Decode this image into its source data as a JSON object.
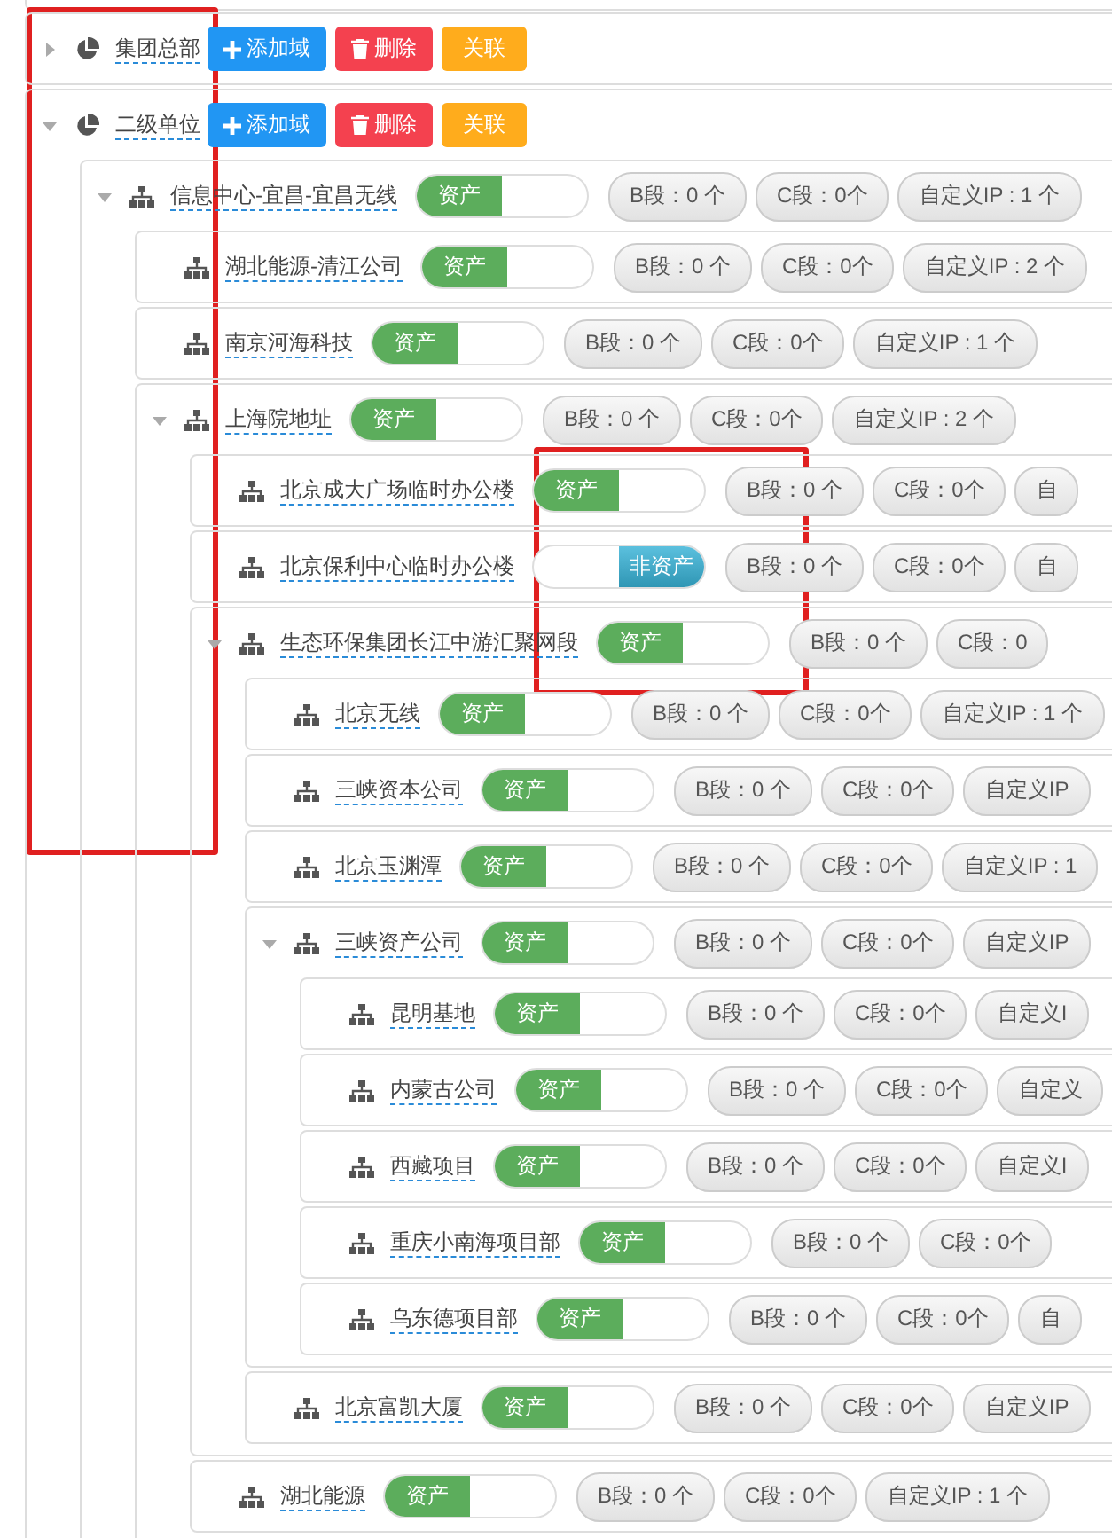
{
  "tree": [
    {
      "kind": "domain",
      "name": "集团总部",
      "expanded": false,
      "buttons": [
        {
          "kind": "add",
          "label": "添加域"
        },
        {
          "kind": "delete",
          "label": "删除"
        },
        {
          "kind": "link",
          "label": "关联"
        }
      ]
    },
    {
      "kind": "domain",
      "name": "二级单位",
      "expanded": true,
      "buttons": [
        {
          "kind": "add",
          "label": "添加域"
        },
        {
          "kind": "delete",
          "label": "删除"
        },
        {
          "kind": "link",
          "label": "关联"
        }
      ],
      "children": [
        {
          "kind": "site",
          "name": "信息中心-宜昌-宜昌无线",
          "expanded": true,
          "asset": true,
          "asset_label": "资产",
          "segments": [
            "B段：0 个",
            "C段：0个",
            "自定义IP : 1 个"
          ],
          "children": [
            {
              "kind": "site",
              "name": "湖北能源-清江公司",
              "asset": true,
              "asset_label": "资产",
              "segments": [
                "B段：0 个",
                "C段：0个",
                "自定义IP : 2 个"
              ]
            },
            {
              "kind": "site",
              "name": "南京河海科技",
              "asset": true,
              "asset_label": "资产",
              "segments": [
                "B段：0 个",
                "C段：0个",
                "自定义IP : 1 个"
              ]
            },
            {
              "kind": "site",
              "name": "上海院地址",
              "expanded": true,
              "asset": true,
              "asset_label": "资产",
              "segments": [
                "B段：0 个",
                "C段：0个",
                "自定义IP : 2 个"
              ],
              "children": [
                {
                  "kind": "site",
                  "name": "北京成大广场临时办公楼",
                  "asset": true,
                  "asset_label": "资产",
                  "segments": [
                    "B段：0 个",
                    "C段：0个",
                    "自"
                  ]
                },
                {
                  "kind": "site",
                  "name": "北京保利中心临时办公楼",
                  "asset": false,
                  "asset_label": "非资产",
                  "segments": [
                    "B段：0 个",
                    "C段：0个",
                    "自"
                  ]
                },
                {
                  "kind": "site",
                  "name": "生态环保集团长江中游汇聚网段",
                  "expanded": true,
                  "asset": true,
                  "asset_label": "资产",
                  "segments": [
                    "B段：0 个",
                    "C段：0"
                  ],
                  "children": [
                    {
                      "kind": "site",
                      "name": "北京无线",
                      "asset": true,
                      "asset_label": "资产",
                      "segments": [
                        "B段：0 个",
                        "C段：0个",
                        "自定义IP : 1 个"
                      ]
                    },
                    {
                      "kind": "site",
                      "name": "三峡资本公司",
                      "asset": true,
                      "asset_label": "资产",
                      "segments": [
                        "B段：0 个",
                        "C段：0个",
                        "自定义IP"
                      ]
                    },
                    {
                      "kind": "site",
                      "name": "北京玉渊潭",
                      "asset": true,
                      "asset_label": "资产",
                      "segments": [
                        "B段：0 个",
                        "C段：0个",
                        "自定义IP : 1"
                      ]
                    },
                    {
                      "kind": "site",
                      "name": "三峡资产公司",
                      "expanded": true,
                      "asset": true,
                      "asset_label": "资产",
                      "segments": [
                        "B段：0 个",
                        "C段：0个",
                        "自定义IP"
                      ],
                      "children": [
                        {
                          "kind": "site",
                          "name": "昆明基地",
                          "asset": true,
                          "asset_label": "资产",
                          "segments": [
                            "B段：0 个",
                            "C段：0个",
                            "自定义I"
                          ]
                        },
                        {
                          "kind": "site",
                          "name": "内蒙古公司",
                          "asset": true,
                          "asset_label": "资产",
                          "segments": [
                            "B段：0 个",
                            "C段：0个",
                            "自定义"
                          ]
                        },
                        {
                          "kind": "site",
                          "name": "西藏项目",
                          "asset": true,
                          "asset_label": "资产",
                          "segments": [
                            "B段：0 个",
                            "C段：0个",
                            "自定义I"
                          ]
                        },
                        {
                          "kind": "site",
                          "name": "重庆小南海项目部",
                          "asset": true,
                          "asset_label": "资产",
                          "segments": [
                            "B段：0 个",
                            "C段：0个"
                          ]
                        },
                        {
                          "kind": "site",
                          "name": "乌东德项目部",
                          "asset": true,
                          "asset_label": "资产",
                          "segments": [
                            "B段：0 个",
                            "C段：0个",
                            "自"
                          ]
                        }
                      ]
                    },
                    {
                      "kind": "site",
                      "name": "北京富凯大厦",
                      "asset": true,
                      "asset_label": "资产",
                      "segments": [
                        "B段：0 个",
                        "C段：0个",
                        "自定义IP"
                      ]
                    }
                  ]
                },
                {
                  "kind": "site",
                  "name": "湖北能源",
                  "asset": true,
                  "asset_label": "资产",
                  "segments": [
                    "B段：0 个",
                    "C段：0个",
                    "自定义IP : 1 个"
                  ]
                }
              ]
            }
          ]
        }
      ]
    }
  ]
}
